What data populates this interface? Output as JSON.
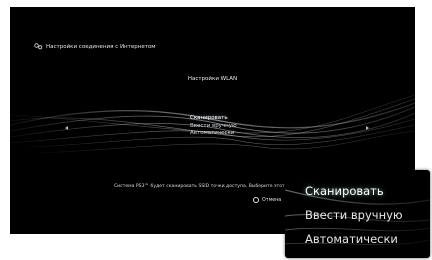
{
  "header": {
    "title": "Настройки соединения с Интернетом",
    "icon": "network-settings-icon"
  },
  "screen_title": "Настройки WLAN",
  "menu": {
    "items": [
      {
        "label": "Сканировать",
        "selected": true
      },
      {
        "label": "Ввести вручную",
        "selected": false
      },
      {
        "label": "Автоматически",
        "selected": false
      }
    ]
  },
  "help_text": "Система PS3™ будет сканировать SSID точки доступа. Выберите этот параметр.",
  "footer": {
    "cancel_label": "Отмена",
    "cancel_icon": "circle-button-icon"
  },
  "zoom": {
    "items": [
      {
        "label": "Сканировать"
      },
      {
        "label": "Ввести вручную"
      },
      {
        "label": "Автоматически"
      }
    ]
  }
}
